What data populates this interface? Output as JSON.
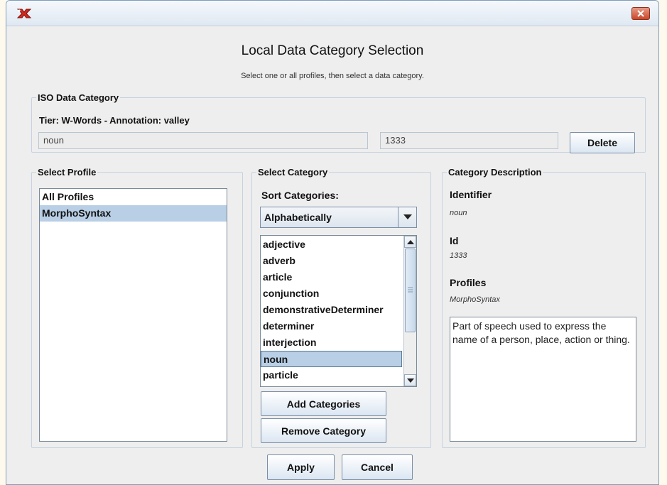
{
  "dialog": {
    "title": "Local Data Category Selection",
    "subtitle": "Select one or all profiles, then select a data category."
  },
  "iso_section": {
    "legend": "ISO Data Category",
    "tier_label": "Tier: W-Words - Annotation: valley",
    "name_value": "noun",
    "id_value": "1333",
    "delete_label": "Delete"
  },
  "profile_section": {
    "legend": "Select Profile",
    "items": [
      "All Profiles",
      "MorphoSyntax"
    ],
    "selected_index": 1
  },
  "category_section": {
    "legend": "Select Category",
    "sort_label": "Sort Categories:",
    "sort_value": "Alphabetically",
    "items": [
      "adjective",
      "adverb",
      "article",
      "conjunction",
      "demonstrativeDeterminer",
      "determiner",
      "interjection",
      "noun",
      "particle"
    ],
    "selected_index": 7,
    "add_label": "Add Categories",
    "remove_label": "Remove Category"
  },
  "description_section": {
    "legend": "Category Description",
    "identifier_label": "Identifier",
    "identifier_value": "noun",
    "id_label": "Id",
    "id_value": "1333",
    "profiles_label": "Profiles",
    "profiles_value": "MorphoSyntax",
    "description_text": "Part of speech used to express the name of a person, place, action or thing."
  },
  "footer": {
    "apply_label": "Apply",
    "cancel_label": "Cancel"
  },
  "icons": {
    "app": "elan-app-icon",
    "close": "close-icon",
    "combo": "chevron-down-icon",
    "scroll_up": "arrow-up-icon",
    "scroll_down": "arrow-down-icon"
  },
  "colors": {
    "selection": "#b8cfe5",
    "close_button": "#c9492b",
    "window_bg": "#eeeeee"
  }
}
